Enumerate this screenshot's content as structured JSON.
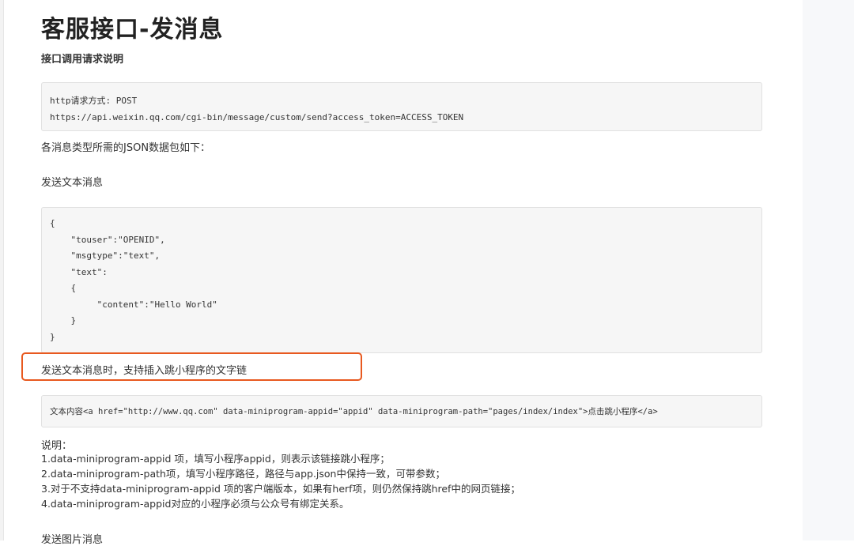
{
  "doc": {
    "title": "客服接口-发消息",
    "subtitle": "接口调用请求说明",
    "request_code": [
      "http请求方式: POST",
      "https://api.weixin.qq.com/cgi-bin/message/custom/send?access_token=ACCESS_TOKEN"
    ],
    "json_intro": "各消息类型所需的JSON数据包如下：",
    "send_text_heading": "发送文本消息",
    "text_json_lines": [
      "{",
      "    \"touser\":\"OPENID\",",
      "    \"msgtype\":\"text\",",
      "    \"text\":",
      "    {",
      "         \"content\":\"Hello World\"",
      "    }",
      "}"
    ],
    "link_heading": "发送文本消息时，支持插入跳小程序的文字链",
    "link_code": "文本内容<a href=\"http://www.qq.com\" data-miniprogram-appid=\"appid\" data-miniprogram-path=\"pages/index/index\">点击跳小程序</a>",
    "notes_heading": "说明：",
    "notes": [
      "1.data-miniprogram-appid 项，填写小程序appid，则表示该链接跳小程序；",
      "2.data-miniprogram-path项，填写小程序路径，路径与app.json中保持一致，可带参数；",
      "3.对于不支持data-miniprogram-appid 项的客户端版本，如果有herf项，则仍然保持跳href中的网页链接；",
      "4.data-miniprogram-appid对应的小程序必须与公众号有绑定关系。"
    ],
    "send_image_heading": "发送图片消息"
  },
  "colors": {
    "highlight_border": "#e8591f",
    "code_background": "#f6f6f6"
  }
}
